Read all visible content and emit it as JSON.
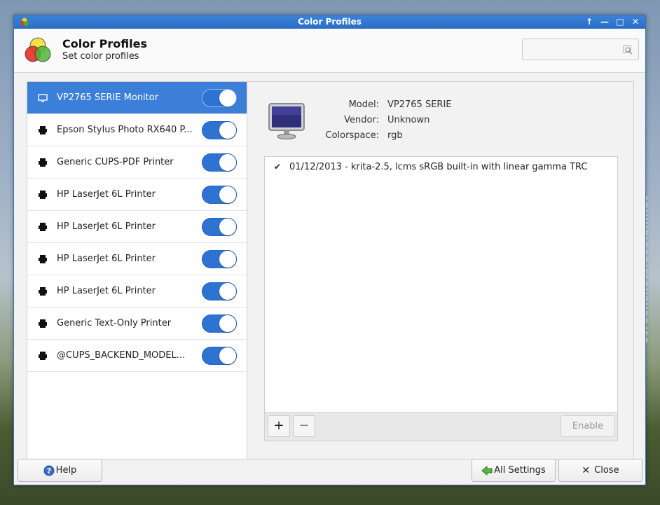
{
  "window": {
    "title": "Color Profiles",
    "controls": [
      "↑",
      "—",
      "□",
      "✕"
    ]
  },
  "header": {
    "title": "Color Profiles",
    "subtitle": "Set color profiles",
    "search_placeholder": ""
  },
  "devices": [
    {
      "label": "VP2765 SERIE Monitor",
      "icon": "monitor-icon",
      "enabled": true,
      "selected": true
    },
    {
      "label": "Epson Stylus Photo RX640 P...",
      "icon": "printer-icon",
      "enabled": true,
      "selected": false
    },
    {
      "label": "Generic CUPS-PDF Printer",
      "icon": "printer-icon",
      "enabled": true,
      "selected": false
    },
    {
      "label": "HP LaserJet 6L Printer",
      "icon": "printer-icon",
      "enabled": true,
      "selected": false
    },
    {
      "label": "HP LaserJet 6L Printer",
      "icon": "printer-icon",
      "enabled": true,
      "selected": false
    },
    {
      "label": "HP LaserJet 6L Printer",
      "icon": "printer-icon",
      "enabled": true,
      "selected": false
    },
    {
      "label": "HP LaserJet 6L Printer",
      "icon": "printer-icon",
      "enabled": true,
      "selected": false
    },
    {
      "label": "Generic Text-Only Printer",
      "icon": "printer-icon",
      "enabled": true,
      "selected": false
    },
    {
      "label": "@CUPS_BACKEND_MODEL...",
      "icon": "printer-icon",
      "enabled": true,
      "selected": false
    }
  ],
  "detail": {
    "props": [
      {
        "key": "Model:",
        "value": "VP2765 SERIE"
      },
      {
        "key": "Vendor:",
        "value": "Unknown"
      },
      {
        "key": "Colorspace:",
        "value": "rgb"
      }
    ],
    "profiles": [
      {
        "checked": true,
        "label": "01/12/2013 - krita-2.5, lcms sRGB built-in with linear gamma TRC"
      }
    ],
    "add_label": "+",
    "remove_label": "−",
    "enable_label": "Enable"
  },
  "footer": {
    "help_label": "Help",
    "all_settings_label": "All Settings",
    "close_label": "Close"
  },
  "watermark": "screenshots.debian.net",
  "colors": {
    "accent": "#3b7fd9",
    "titlebar": "#2a6ec4",
    "toggle_on": "#2f73d2"
  }
}
